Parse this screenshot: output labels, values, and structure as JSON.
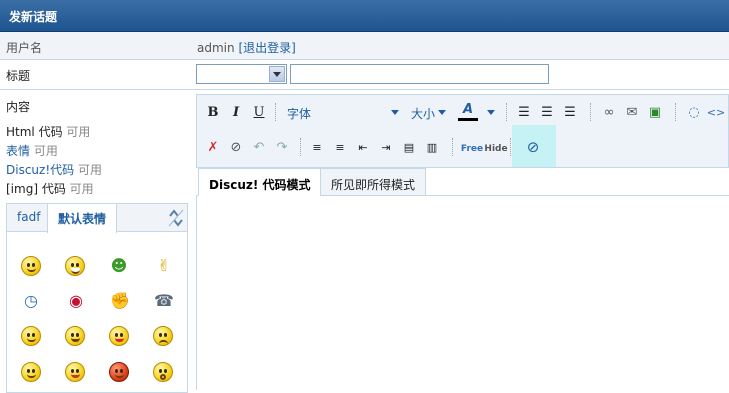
{
  "header": {
    "title": "发新话题"
  },
  "user_row": {
    "label": "用户名",
    "username": "admin",
    "logout_label": "[退出登录]"
  },
  "subject_row": {
    "label": "标题",
    "category_value": "",
    "subject_value": ""
  },
  "content": {
    "label": "内容",
    "modes": [
      {
        "name": "Html 代码",
        "status": "可用"
      },
      {
        "name": "表情",
        "status": "可用"
      },
      {
        "name": "Discuz!代码",
        "status": "可用"
      },
      {
        "name": "[img] 代码",
        "status": "可用"
      }
    ]
  },
  "smilies": {
    "tabs": [
      "fadf",
      "默认表情"
    ],
    "active_tab": "默认表情",
    "icons": [
      "smile-icon",
      "grin-icon",
      "hug-icon",
      "victory-hand-icon",
      "clock-icon",
      "lips-icon",
      "handshake-icon",
      "phone-icon",
      "shy-icon",
      "angry-icon",
      "tongue-icon",
      "sad-icon",
      "cry-icon",
      "sleepy-icon",
      "mad-icon",
      "shock-icon"
    ]
  },
  "toolbar": {
    "bold": "B",
    "italic": "I",
    "underline": "U",
    "font_label": "字体",
    "size_label": "大小",
    "color_label": "A",
    "free_label": "Free",
    "hide_label": "Hide"
  },
  "editor_tabs": [
    "Discuz! 代码模式",
    "所见即所得模式"
  ],
  "colors": {
    "header": "#1e5590",
    "link": "#1f5fa1",
    "border": "#c5d8e8"
  }
}
